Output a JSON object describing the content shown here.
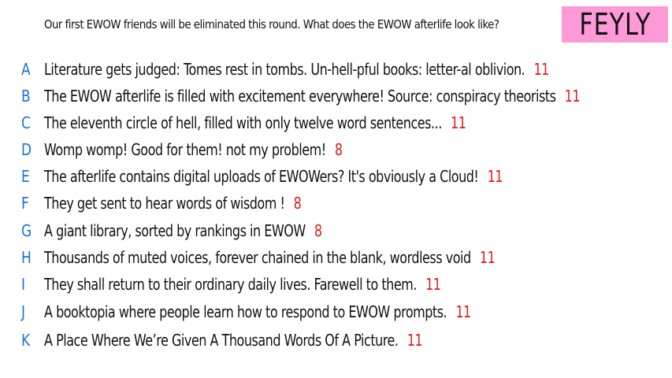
{
  "header": {
    "prompt": "Our first EWOW friends will be eliminated this round. What does the EWOW afterlife look like?",
    "badge": "FEYLY"
  },
  "colors": {
    "badge_bg": "#ff9ad9",
    "letter": "#1e6fd9",
    "score": "#e01b1b"
  },
  "responses": [
    {
      "letter": "A",
      "text": "Literature gets judged: Tomes rest in tombs. Un-hell-pful books: letter-al oblivion.",
      "score": "11"
    },
    {
      "letter": "B",
      "text": "The EWOW afterlife is filled with excitement everywhere! Source: conspiracy theorists",
      "score": "11"
    },
    {
      "letter": "C",
      "text": "The eleventh circle of hell, filled with only twelve word sentences...",
      "score": "11"
    },
    {
      "letter": "D",
      "text": "Womp womp! Good for them! not my problem!",
      "score": "8"
    },
    {
      "letter": "E",
      "text": "The afterlife contains digital uploads of EWOWers? It's obviously a Cloud!",
      "score": "11"
    },
    {
      "letter": "F",
      "text": "They get sent to hear words of wisdom !",
      "score": "8"
    },
    {
      "letter": "G",
      "text": "A giant library, sorted by rankings in EWOW",
      "score": "8"
    },
    {
      "letter": "H",
      "text": "Thousands of muted voices, forever chained in the blank, wordless void",
      "score": "11"
    },
    {
      "letter": "I",
      "text": "They shall return to their ordinary daily lives. Farewell to them.",
      "score": "11"
    },
    {
      "letter": "J",
      "text": "A booktopia where people learn how to respond to EWOW prompts.",
      "score": "11"
    },
    {
      "letter": "K",
      "text": "A Place Where We’re Given A Thousand Words Of A Picture.",
      "score": "11"
    }
  ]
}
